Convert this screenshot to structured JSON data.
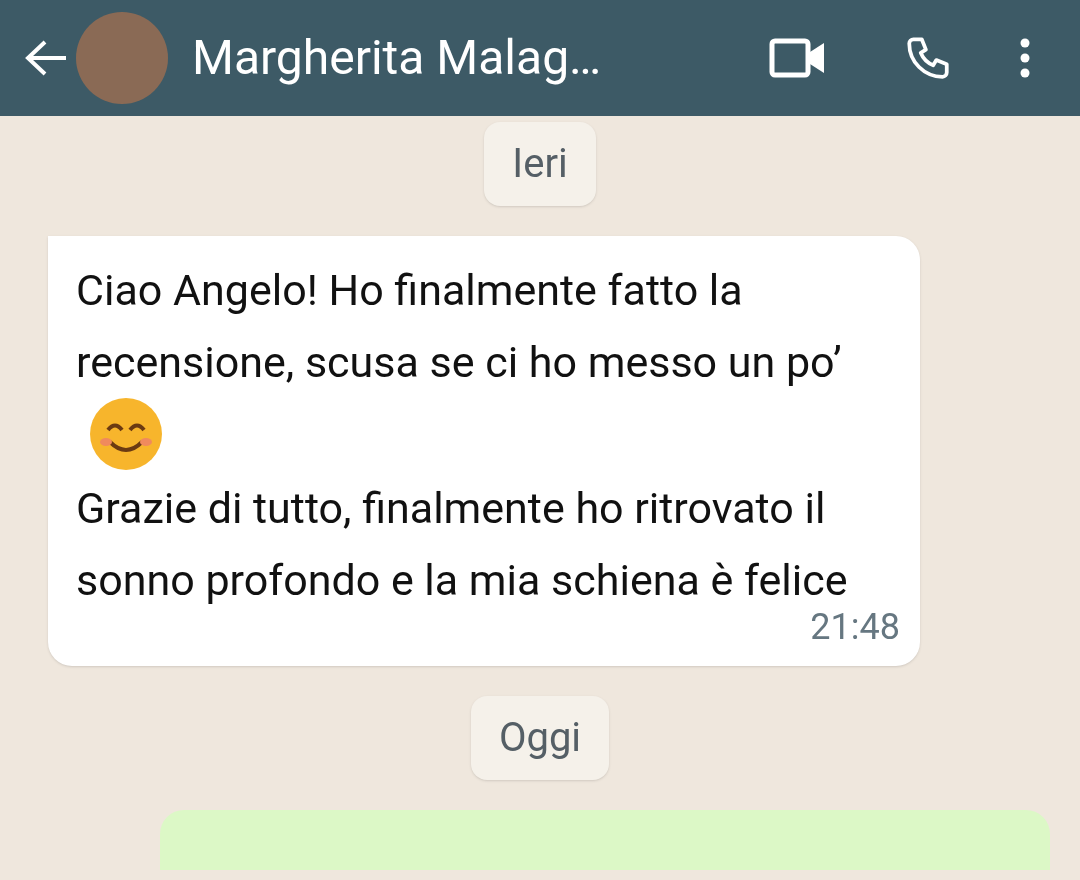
{
  "header": {
    "contact_name": "Margherita Malag…"
  },
  "chat": [
    {
      "kind": "date",
      "text": "Ieri"
    },
    {
      "kind": "incoming",
      "paragraphs": [
        "Ciao Angelo! Ho finalmente fatto la recensione, scusa se ci ho messo un po’",
        "Grazie di tutto, finalmente ho ritrovato il sonno profondo e la mia schiena è felice"
      ],
      "time": "21:48"
    },
    {
      "kind": "date",
      "text": "Oggi"
    },
    {
      "kind": "outgoing"
    }
  ]
}
